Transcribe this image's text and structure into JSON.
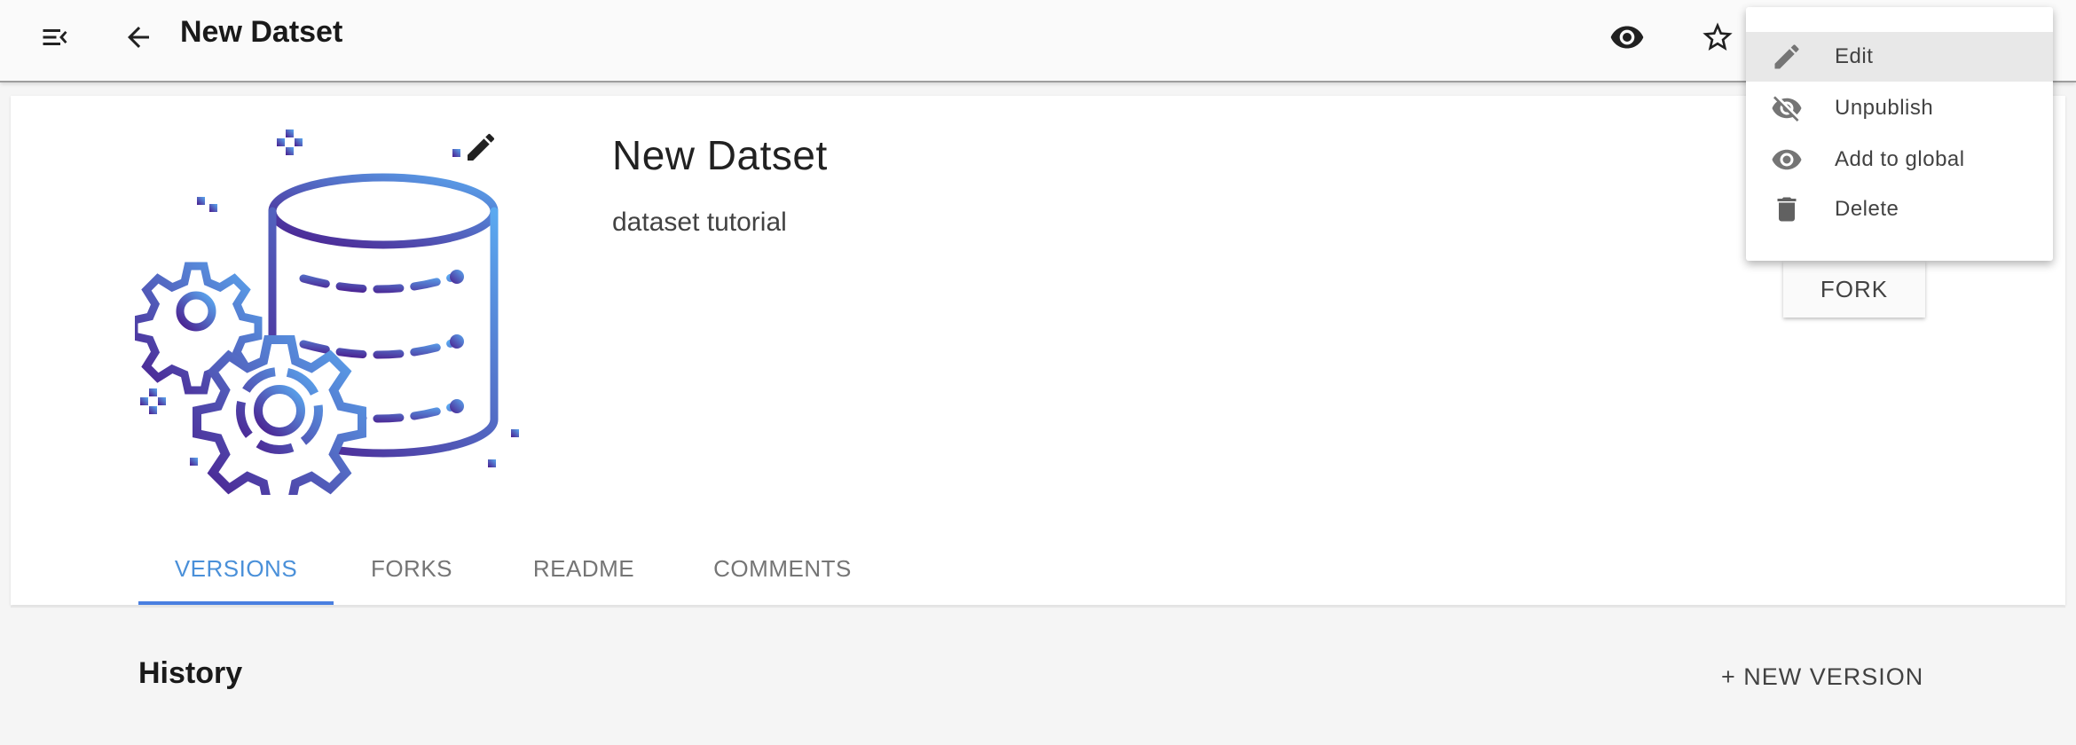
{
  "app_bar": {
    "title": "New Datset",
    "icons": [
      "menu-collapse-icon",
      "back-arrow-icon",
      "eye-icon",
      "star-icon"
    ]
  },
  "dataset": {
    "title": "New Datset",
    "description": "dataset tutorial",
    "fork_label": "FORK"
  },
  "tabs": [
    {
      "label": "VERSIONS",
      "active": true
    },
    {
      "label": "FORKS",
      "active": false
    },
    {
      "label": "README",
      "active": false
    },
    {
      "label": "COMMENTS",
      "active": false
    }
  ],
  "history": {
    "title": "History",
    "new_version_label": "+ NEW VERSION"
  },
  "menu": {
    "items": [
      {
        "label": "Edit",
        "icon": "pencil-icon"
      },
      {
        "label": "Unpublish",
        "icon": "eye-off-icon"
      },
      {
        "label": "Add to global",
        "icon": "eye-icon"
      },
      {
        "label": "Delete",
        "icon": "trash-icon"
      }
    ]
  },
  "colors": {
    "accent": "#4a90d9",
    "illustration_gradient": [
      "#4a1b8c",
      "#5aa9f0"
    ]
  }
}
